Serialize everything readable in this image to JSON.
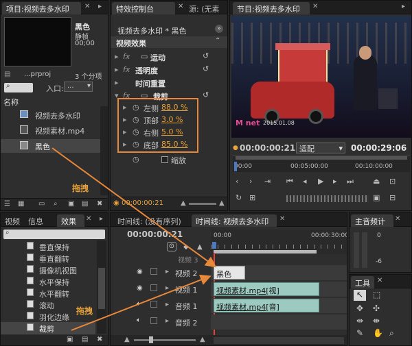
{
  "project": {
    "tab": "项目:视频去多水印",
    "clip_name": "黑色",
    "clip_type": "静帧",
    "clip_time": "00;00",
    "file": "...prproj",
    "count": "3 个分项",
    "entry_label": "入口:",
    "entry_value": "...",
    "name_header": "名称",
    "items": [
      "视频去多水印",
      "视频素材.mp4",
      "黑色"
    ],
    "drag_label": "拖拽"
  },
  "effect_controls": {
    "tabs": [
      "特效控制台",
      "源: (无素"
    ],
    "seq_title": "视频去多水印 * 黑色",
    "video_effects": "视频效果",
    "effects": [
      "运动",
      "透明度",
      "时间重置",
      "裁剪"
    ],
    "crop_params": [
      {
        "label": "左侧",
        "value": "88.0 %"
      },
      {
        "label": "顶部",
        "value": "3.0 %"
      },
      {
        "label": "右侧",
        "value": "5.0 %"
      },
      {
        "label": "底部",
        "value": "85.0 %"
      }
    ],
    "zoom_label": "缩放",
    "timecode": "00:00:00:21"
  },
  "program": {
    "tab": "节目:视频去多水印",
    "timecode": "00:00:00:21",
    "fit": "适配",
    "duration": "00:00:29:06",
    "ruler": [
      "00:00",
      "00:05:00:00",
      "00:10:00:00"
    ],
    "overlay_date": "2015.01.08",
    "overlay_brand": "M net"
  },
  "effects_panel": {
    "tabs": [
      "视频",
      "信息",
      "效果"
    ],
    "items": [
      "垂直保持",
      "垂直翻转",
      "摄像机视图",
      "水平保持",
      "水平翻转",
      "滚动",
      "羽化边缘",
      "裁剪"
    ],
    "drag_label": "拖拽"
  },
  "timeline": {
    "tabs": [
      "时间线: (没有序列)",
      "时间线: 视频去多水印"
    ],
    "timecode": "00:00:00:21",
    "ruler": [
      "00:00",
      "00:00:30:00"
    ],
    "tracks": [
      "视频 3",
      "视频 2",
      "视频 1",
      "音频 1",
      "音频 2"
    ],
    "clips": {
      "v2": "黑色",
      "v1_name": "视频素材.mp4",
      "v1_tag": "[视]",
      "a1_name": "视频素材.mp4",
      "a1_tag": "[音]"
    }
  },
  "audio_meter": {
    "title": "主音频计",
    "marks": [
      "0",
      "-6"
    ]
  },
  "tools": {
    "title": "工具"
  }
}
